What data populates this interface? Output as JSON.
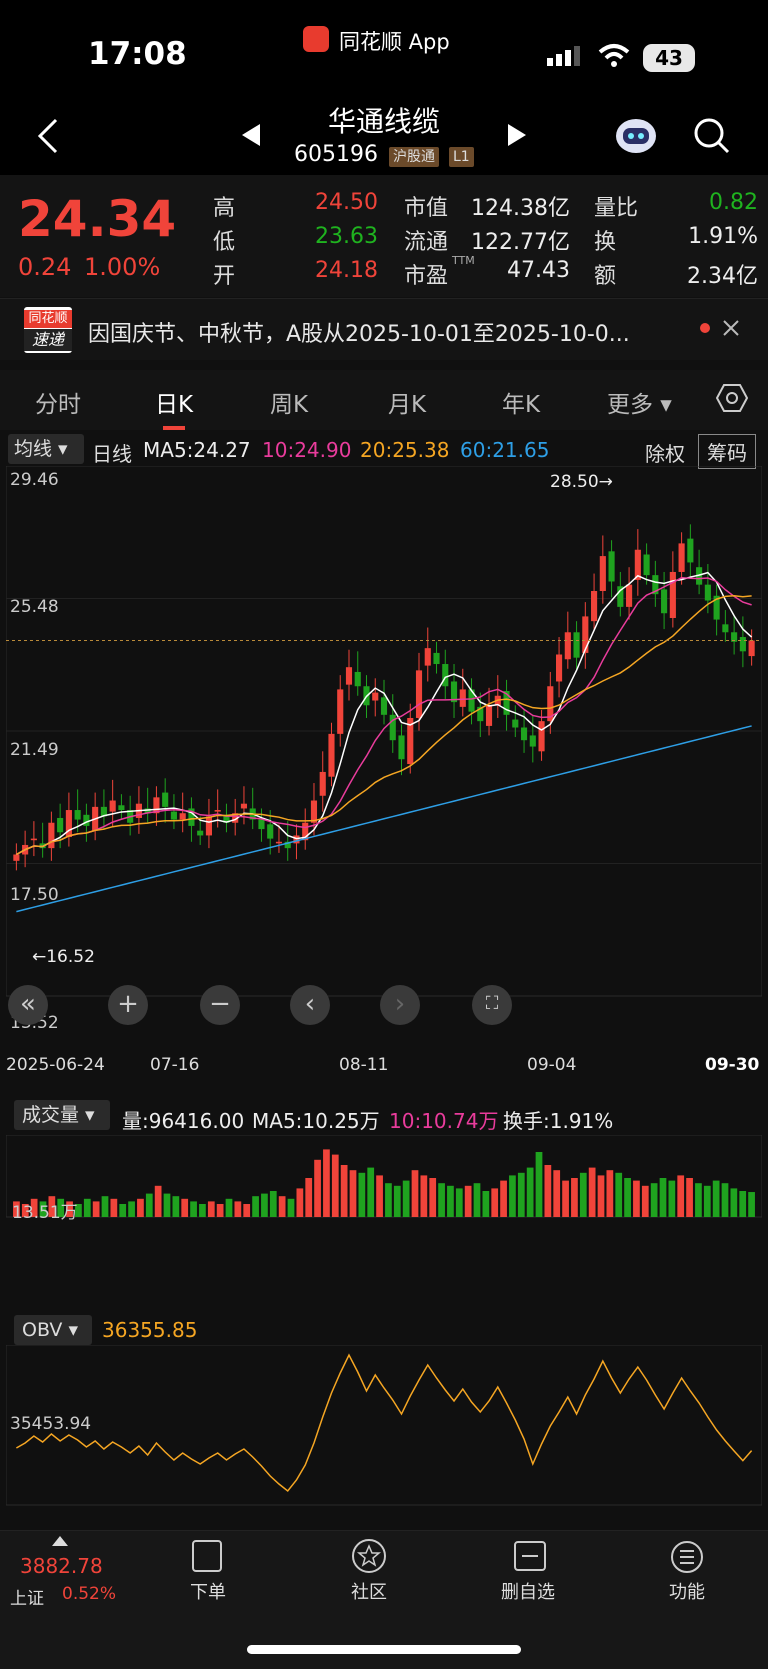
{
  "status": {
    "time": "17:08",
    "app": "同花顺 App",
    "battery": "43"
  },
  "header": {
    "name": "华通线缆",
    "code": "605196",
    "tag1": "沪股通",
    "tag2": "L1"
  },
  "quote": {
    "price": "24.34",
    "change": "0.24",
    "pct": "1.00%",
    "high_label": "高",
    "high": "24.50",
    "low_label": "低",
    "low": "23.63",
    "open_label": "开",
    "open": "24.18",
    "mktcap_label": "市值",
    "mktcap": "124.38亿",
    "float_label": "流通",
    "float": "122.77亿",
    "pe_label": "市盈",
    "pe_sup": "TTM",
    "pe": "47.43",
    "volratio_label": "量比",
    "volratio": "0.82",
    "turn_label": "换",
    "turn": "1.91%",
    "amt_label": "额",
    "amt": "2.34亿"
  },
  "news": {
    "badge_top": "同花顺",
    "badge_bottom": "速递",
    "text": "因国庆节、中秋节，A股从2025-10-01至2025-10-0..."
  },
  "tabs": [
    "分时",
    "日K",
    "周K",
    "月K",
    "年K",
    "更多"
  ],
  "ma_bar": {
    "type": "均线",
    "period": "日线",
    "ma5": "MA5:24.27",
    "ma10": "10:24.90",
    "ma20": "20:25.38",
    "ma60": "60:21.65",
    "fq": "除权",
    "chips": "筹码"
  },
  "kchart": {
    "y_labels": [
      "29.46",
      "25.48",
      "21.49",
      "17.50",
      "13.52"
    ],
    "high_mark": "28.50→",
    "low_mark": "←16.52",
    "x_labels": [
      "2025-06-24",
      "07-16",
      "08-11",
      "09-04",
      "09-30"
    ]
  },
  "vol_bar": {
    "name": "成交量",
    "vol": "量:96416.00",
    "ma5": "MA5:10.25万",
    "ma10": "10:10.74万",
    "turn": "换手:1.91%",
    "y_label": "13.51万"
  },
  "obv_bar": {
    "name": "OBV",
    "value": "36355.85",
    "y_label": "35453.94"
  },
  "bottom": {
    "index_val": "3882.78",
    "index_name": "上证",
    "index_pct": "0.52%",
    "order": "下单",
    "community": "社区",
    "watch": "删自选",
    "func": "功能"
  },
  "colors": {
    "up": "#f0443a",
    "down": "#1fa31f",
    "ma5": "#ffffff",
    "ma10": "#e93c9c",
    "ma20": "#f5a623",
    "ma60": "#2e9fe6"
  },
  "chart_data": {
    "type": "candlestick",
    "title": "华通线缆 日K",
    "x_start": "2025-06-24",
    "x_end": "2025-09-30",
    "ylim": [
      13.52,
      29.46
    ],
    "closes": [
      17.6,
      17.9,
      18.1,
      17.8,
      18.6,
      18.3,
      19.0,
      18.7,
      18.5,
      19.1,
      18.8,
      19.3,
      19.0,
      18.6,
      19.2,
      18.9,
      19.4,
      19.1,
      18.7,
      18.9,
      18.5,
      18.2,
      18.8,
      19.0,
      18.6,
      18.9,
      19.2,
      18.7,
      18.4,
      18.1,
      18.0,
      17.8,
      18.2,
      18.6,
      19.3,
      20.2,
      21.4,
      22.8,
      23.5,
      22.9,
      22.3,
      22.7,
      22.0,
      21.2,
      20.6,
      21.9,
      23.4,
      24.1,
      23.6,
      22.9,
      22.4,
      22.8,
      22.1,
      21.8,
      22.3,
      22.6,
      22.0,
      21.6,
      21.2,
      21.0,
      21.8,
      22.9,
      23.9,
      24.6,
      23.8,
      25.1,
      25.9,
      27.0,
      26.2,
      25.4,
      26.1,
      27.2,
      26.4,
      25.8,
      25.2,
      26.5,
      27.4,
      26.8,
      26.1,
      25.6,
      25.0,
      24.6,
      24.3,
      24.0,
      24.34
    ],
    "volumes": [
      6,
      5,
      7,
      6,
      8,
      7,
      6,
      5,
      7,
      6,
      8,
      7,
      5,
      6,
      7,
      9,
      12,
      9,
      8,
      7,
      6,
      5,
      6,
      5,
      7,
      6,
      5,
      8,
      9,
      10,
      8,
      7,
      11,
      15,
      22,
      26,
      24,
      20,
      18,
      17,
      19,
      16,
      13,
      12,
      14,
      18,
      16,
      15,
      13,
      12,
      11,
      12,
      13,
      10,
      11,
      14,
      16,
      17,
      19,
      25,
      20,
      18,
      14,
      15,
      17,
      19,
      16,
      18,
      17,
      15,
      14,
      12,
      13,
      15,
      14,
      16,
      15,
      13,
      12,
      14,
      13,
      11,
      10,
      9.6
    ],
    "ma5_last": 24.27,
    "ma10_last": 24.9,
    "ma20_last": 25.38,
    "ma60_last": 21.65,
    "obv_last": 36355.85
  }
}
